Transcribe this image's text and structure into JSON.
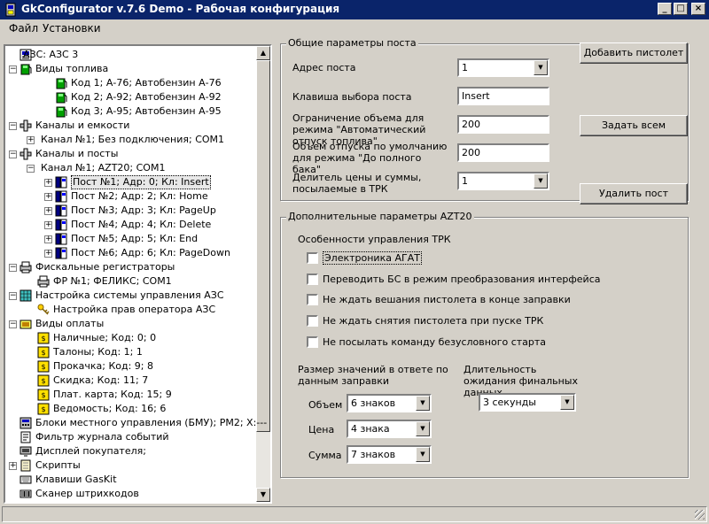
{
  "window": {
    "title": "GkConfigurator v.7.6 Demo - Рабочая конфигурация"
  },
  "menu": [
    "Файл",
    "Установки"
  ],
  "tree": [
    {
      "label": "АЗС: АЗС 3",
      "icon": "station-icon",
      "level": 0,
      "expander": "none"
    },
    {
      "label": "Виды топлива",
      "icon": "fuel-icon",
      "level": 0,
      "expander": "minus"
    },
    {
      "label": "Код 1; А-76; Автобензин А-76",
      "icon": "fuel-icon",
      "level": 2,
      "expander": "none"
    },
    {
      "label": "Код 2; А-92; Автобензин А-92",
      "icon": "fuel-icon",
      "level": 2,
      "expander": "none"
    },
    {
      "label": "Код 3; А-95; Автобензин А-95",
      "icon": "fuel-icon",
      "level": 2,
      "expander": "none"
    },
    {
      "label": "Каналы и емкости",
      "icon": "pipe-icon",
      "level": 0,
      "expander": "minus"
    },
    {
      "label": "Канал №1; Без подключения; COM1",
      "icon": "",
      "level": 1,
      "expander": "plus"
    },
    {
      "label": "Каналы и посты",
      "icon": "pipe-icon",
      "level": 0,
      "expander": "minus"
    },
    {
      "label": "Канал №1; AZT20; COM1",
      "icon": "",
      "level": 1,
      "expander": "minus"
    },
    {
      "label": "Пост №1; Адр: 0; Кл: Insert",
      "icon": "dispenser-icon",
      "level": 2,
      "expander": "plus",
      "selected": true
    },
    {
      "label": "Пост №2; Адр: 2; Кл: Home",
      "icon": "dispenser-icon",
      "level": 2,
      "expander": "plus"
    },
    {
      "label": "Пост №3; Адр: 3; Кл: PageUp",
      "icon": "dispenser-icon",
      "level": 2,
      "expander": "plus"
    },
    {
      "label": "Пост №4; Адр: 4; Кл: Delete",
      "icon": "dispenser-icon",
      "level": 2,
      "expander": "plus"
    },
    {
      "label": "Пост №5; Адр: 5; Кл: End",
      "icon": "dispenser-icon",
      "level": 2,
      "expander": "plus"
    },
    {
      "label": "Пост №6; Адр: 6; Кл: PageDown",
      "icon": "dispenser-icon",
      "level": 2,
      "expander": "plus"
    },
    {
      "label": "Фискальные регистраторы",
      "icon": "printer-icon",
      "level": 0,
      "expander": "minus"
    },
    {
      "label": "ФР №1; ФЕЛИКС; COM1",
      "icon": "printer-icon",
      "level": 1,
      "expander": "none"
    },
    {
      "label": "Настройка системы управления АЗС",
      "icon": "grid-icon",
      "level": 0,
      "expander": "minus"
    },
    {
      "label": "Настройка прав оператора АЗС",
      "icon": "key-icon",
      "level": 1,
      "expander": "none"
    },
    {
      "label": "Виды оплаты",
      "icon": "cash-icon",
      "level": 0,
      "expander": "minus"
    },
    {
      "label": "Наличные; Код: 0; 0",
      "icon": "coin-icon",
      "level": 1,
      "expander": "none"
    },
    {
      "label": "Талоны; Код: 1; 1",
      "icon": "coin-icon",
      "level": 1,
      "expander": "none"
    },
    {
      "label": "Прокачка; Код: 9; 8",
      "icon": "coin-icon",
      "level": 1,
      "expander": "none"
    },
    {
      "label": "Скидка; Код: 11; 7",
      "icon": "coin-icon",
      "level": 1,
      "expander": "none"
    },
    {
      "label": "Плат. карта; Код: 15; 9",
      "icon": "coin-icon",
      "level": 1,
      "expander": "none"
    },
    {
      "label": "Ведомость; Код: 16; 6",
      "icon": "coin-icon",
      "level": 1,
      "expander": "none"
    },
    {
      "label": "Блоки местного управления (БМУ);  PM2;  X:---",
      "icon": "keypad-icon",
      "level": 0,
      "expander": "none"
    },
    {
      "label": "Фильтр журнала событий",
      "icon": "journal-icon",
      "level": 0,
      "expander": "none"
    },
    {
      "label": "Дисплей покупателя;",
      "icon": "display-icon",
      "level": 0,
      "expander": "none"
    },
    {
      "label": "Скрипты",
      "icon": "script-icon",
      "level": 0,
      "expander": "plus"
    },
    {
      "label": "Клавиши GasKit",
      "icon": "keyboard-icon",
      "level": 0,
      "expander": "none"
    },
    {
      "label": "Сканер штрихкодов",
      "icon": "scanner-icon",
      "level": 0,
      "expander": "none"
    }
  ],
  "general": {
    "legend": "Общие параметры поста",
    "address_label": "Адрес поста",
    "address_value": "1",
    "key_label": "Клавиша выбора поста",
    "key_value": "Insert",
    "limit_label": "Ограничение объема для режима \"Автоматический отпуск топлива\"",
    "limit_value": "200",
    "default_label": "Объем отпуска по умолчанию для режима \"До полного бака\"",
    "default_value": "200",
    "divider_label": "Делитель цены и суммы, посылаемые в ТРК",
    "divider_value": "1"
  },
  "buttons": {
    "add": "Добавить пистолет",
    "set_all": "Задать всем",
    "delete": "Удалить пост"
  },
  "extra": {
    "legend": "Дополнительные параметры AZT20",
    "section_label": "Особенности управления ТРК",
    "checks": [
      "Электроника АГАТ",
      "Переводить БС в режим преобразования интерфейса",
      "Не ждать вешания пистолета в конце заправки",
      "Не ждать снятия пистолета при пуске ТРК",
      "Не посылать команду безусловного старта"
    ],
    "size_label": "Размер значений в ответе по данным заправки",
    "volume_label": "Объем",
    "volume_value": "6 знаков",
    "price_label": "Цена",
    "price_value": "4 знака",
    "sum_label": "Сумма",
    "sum_value": "7 знаков",
    "wait_label": "Длительность ожидания финальных данных",
    "wait_value": "3 секунды"
  }
}
